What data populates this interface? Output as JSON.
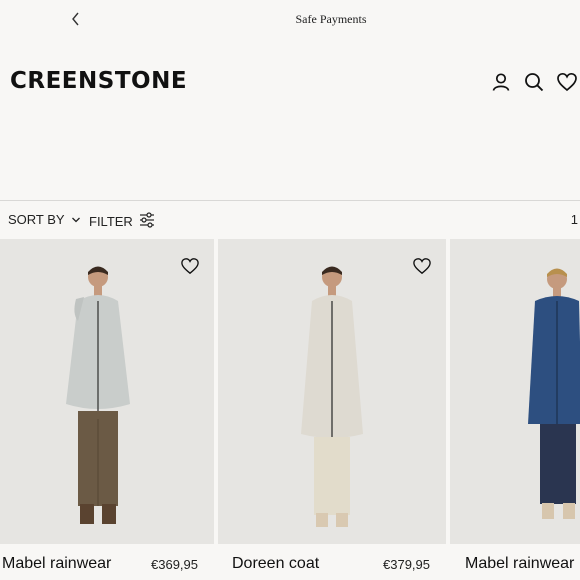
{
  "announcement": {
    "message": "Safe Payments"
  },
  "brand": {
    "logo": "CREENSTONE"
  },
  "header_icons": [
    "account-icon",
    "search-icon",
    "wishlist-icon"
  ],
  "toolbar": {
    "sort_label": "SORT BY",
    "filter_label": "FILTER",
    "count": "1"
  },
  "products": [
    {
      "name": "Mabel rainwear",
      "price": "€369,95",
      "coat_color": "#c9cdcb",
      "pants_color": "#6b5a45"
    },
    {
      "name": "Doreen coat",
      "price": "€379,95",
      "coat_color": "#dedad1",
      "pants_color": "#e2dccb"
    },
    {
      "name": "Mabel rainwear",
      "price": "",
      "coat_color": "#2d4f80",
      "pants_color": "#2a3550"
    }
  ],
  "colors": {
    "background": "#f8f7f5",
    "text": "#111111",
    "photo_bg": "#e6e5e2"
  }
}
